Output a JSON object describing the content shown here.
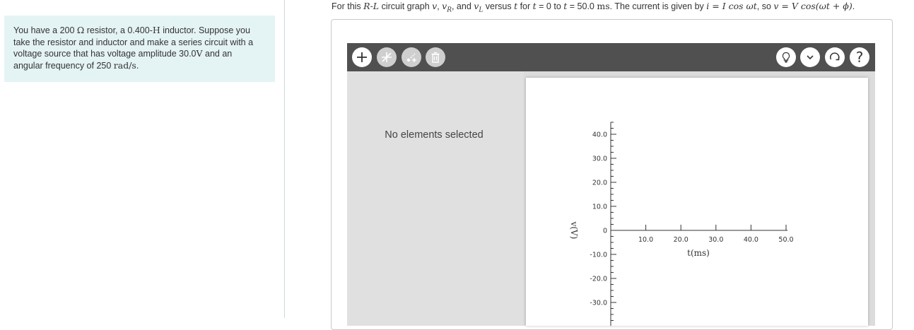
{
  "problem": {
    "line1_a": "You have a 200 ",
    "line1_ohm": "Ω",
    "line1_b": " resistor, a 0.400-",
    "line1_h": "H",
    "line1_c": " inductor. Suppose you",
    "line2": "take the resistor and inductor and make a series circuit with a",
    "line3_a": "voltage source that has voltage amplitude 30.0",
    "line3_v": "V",
    "line3_b": " and an",
    "line4_a": "angular frequency of 250 ",
    "line4_unit": "rad/s",
    "line4_b": "."
  },
  "question": {
    "p1": "For this ",
    "rl": "R-L",
    "p2": " circuit graph ",
    "v": "v",
    "p3": ", ",
    "vr": "v",
    "vr_sub": "R",
    "p4": ", and ",
    "vl": "v",
    "vl_sub": "L",
    "p5": " versus ",
    "t1": "t",
    "p6": " for ",
    "t2": "t",
    "p7": " = 0 to ",
    "t3": "t",
    "p8": " = 50.0 ",
    "ms": "ms",
    "p9": ". The current is given by ",
    "eq1": "i = I cos ωt",
    "p10": ", so ",
    "eq2": "v = V cos(ωt + ϕ)",
    "p11": "."
  },
  "tool": {
    "toolbar_color": "#505050",
    "left_buttons": [
      "add-icon",
      "no-line-icon",
      "add-point-icon",
      "trash-icon"
    ],
    "right_buttons": [
      "lightbulb-icon",
      "chevron-down-icon",
      "rotate-icon",
      "help-icon"
    ],
    "help_glyph": "?",
    "no_selection_text": "No elements selected"
  },
  "chart_data": {
    "type": "line",
    "series": [],
    "xlabel": "t(ms)",
    "ylabel": "v(V)",
    "x_ticks": [
      "10.0",
      "20.0",
      "30.0",
      "40.0",
      "50.0"
    ],
    "y_ticks": [
      "40.0",
      "30.0",
      "20.0",
      "10.0",
      "0",
      "-10.0",
      "-20.0",
      "-30.0"
    ],
    "xlim": [
      0,
      50
    ],
    "ylim": [
      -30,
      40
    ],
    "grid": false
  }
}
